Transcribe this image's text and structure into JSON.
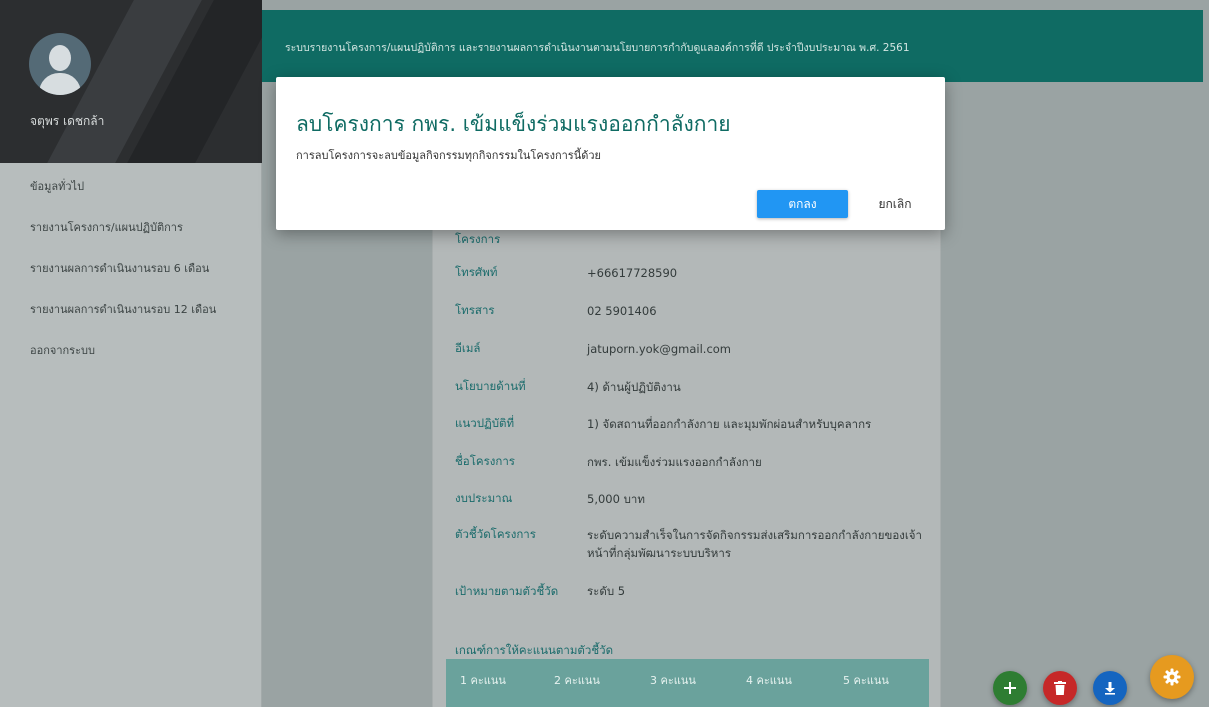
{
  "user": {
    "name": "จตุพร เดชกล้า"
  },
  "sidebar": {
    "items": [
      {
        "label": "ข้อมูลทั่วไป"
      },
      {
        "label": "รายงานโครงการ/แผนปฏิบัติการ"
      },
      {
        "label": "รายงานผลการดำเนินงานรอบ 6 เดือน"
      },
      {
        "label": "รายงานผลการดำเนินงานรอบ 12 เดือน"
      },
      {
        "label": "ออกจากระบบ"
      }
    ]
  },
  "header": {
    "title": "ระบบรายงานโครงการ/แผนปฏิบัติการ และรายงานผลการดำเนินงานตามนโยบายการกำกับดูแลองค์การที่ดี ประจำปีงบประมาณ พ.ศ. 2561"
  },
  "details": {
    "partial_label": "โครงการ",
    "phone": {
      "label": "โทรศัพท์",
      "value": "+66617728590"
    },
    "fax": {
      "label": "โทรสาร",
      "value": "02 5901406"
    },
    "email": {
      "label": "อีเมล์",
      "value": "jatuporn.yok@gmail.com"
    },
    "policy": {
      "label": "นโยบายด้านที่",
      "value": "4) ด้านผู้ปฏิบัติงาน"
    },
    "practice": {
      "label": "แนวปฏิบัติที่",
      "value": "1) จัดสถานที่ออกกำลังกาย และมุมพักผ่อนสำหรับบุคลากร"
    },
    "project_name": {
      "label": "ชื่อโครงการ",
      "value": "กพร. เข้มแข็งร่วมแรงออกกำลังกาย"
    },
    "budget": {
      "label": "งบประมาณ",
      "value": "5,000 บาท"
    },
    "indicator": {
      "label": "ตัวชี้วัดโครงการ",
      "value": "ระดับความสำเร็จในการจัดกิจกรรมส่งเสริมการออกกำลังกายของเจ้าหน้าที่กลุ่มพัฒนาระบบบริหาร"
    },
    "target": {
      "label": "เป้าหมายตามตัวชี้วัด",
      "value": "ระดับ 5"
    },
    "criteria_title": "เกณฑ์การให้คะแนนตามตัวชี้วัด",
    "scores": [
      "1 คะแนน",
      "2 คะแนน",
      "3 คะแนน",
      "4 คะแนน",
      "5 คะแนน"
    ]
  },
  "dialog": {
    "title": "ลบโครงการ กพร. เข้มแข็งร่วมแรงออกกำลังกาย",
    "message": "การลบโครงการจะลบข้อมูลกิจกรรมทุกกิจกรรมในโครงการนี้ด้วย",
    "ok_label": "ตกลง",
    "cancel_label": "ยกเลิก"
  },
  "fabs": [
    {
      "icon": "plus-icon",
      "color": "#2e7d32"
    },
    {
      "icon": "trash-icon",
      "color": "#c62828"
    },
    {
      "icon": "download-icon",
      "color": "#1565c0"
    },
    {
      "icon": "gear-icon",
      "color": "#e69a1f"
    }
  ]
}
